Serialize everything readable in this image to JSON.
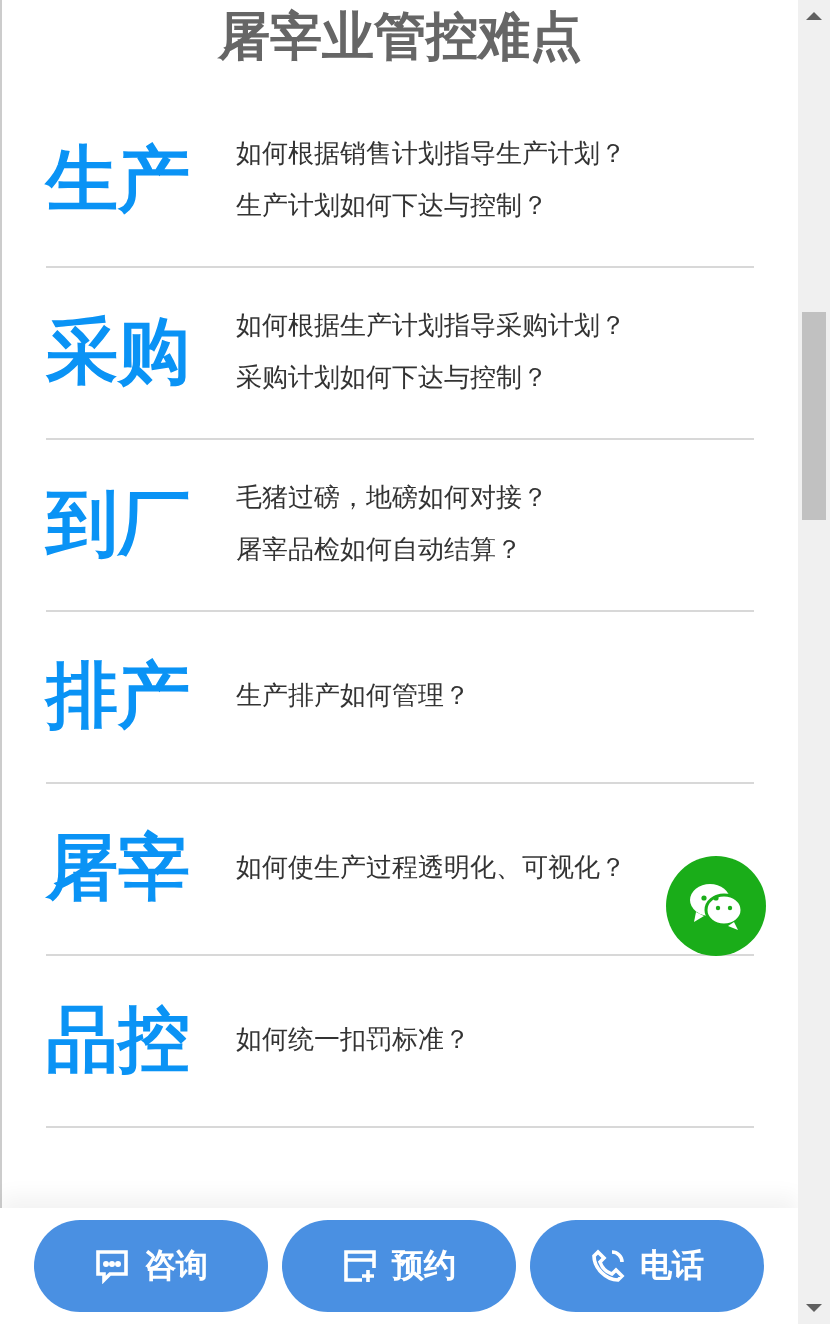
{
  "title": "屠宰业管控难点",
  "items": [
    {
      "label": "生产",
      "questions": [
        "如何根据销售计划指导生产计划？",
        "生产计划如何下达与控制？"
      ]
    },
    {
      "label": "采购",
      "questions": [
        "如何根据生产计划指导采购计划？",
        "采购计划如何下达与控制？"
      ]
    },
    {
      "label": "到厂",
      "questions": [
        "毛猪过磅，地磅如何对接？",
        "屠宰品检如何自动结算？"
      ]
    },
    {
      "label": "排产",
      "questions": [
        "生产排产如何管理？"
      ]
    },
    {
      "label": "屠宰",
      "questions": [
        "如何使生产过程透明化、可视化？"
      ]
    },
    {
      "label": "品控",
      "questions": [
        "如何统一扣罚标准？"
      ]
    }
  ],
  "bottom_bar": [
    {
      "kind": "chat",
      "label": "咨询"
    },
    {
      "kind": "calendar",
      "label": "预约"
    },
    {
      "kind": "phone",
      "label": "电话"
    }
  ]
}
